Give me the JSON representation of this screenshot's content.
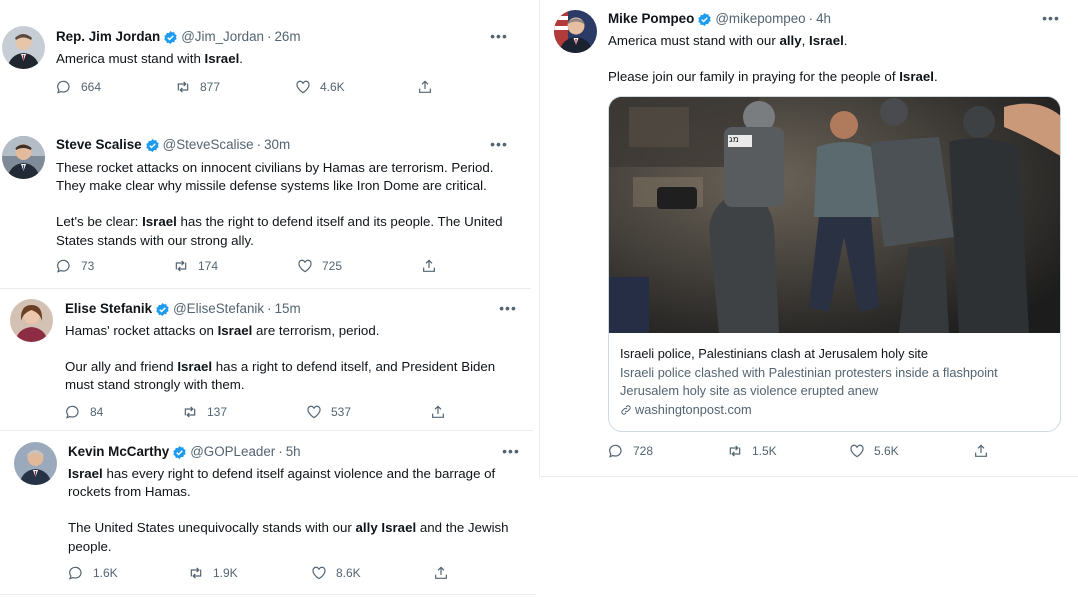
{
  "tweets": [
    {
      "name": "Rep. Jim Jordan",
      "handle": "@Jim_Jordan",
      "dot": "·",
      "time": "26m",
      "paragraphs": [
        [
          {
            "t": "America must stand with "
          },
          {
            "t": "Israel",
            "b": true
          },
          {
            "t": "."
          }
        ]
      ],
      "replies": "664",
      "retweets": "877",
      "likes": "4.6K"
    },
    {
      "name": "Steve Scalise",
      "handle": "@SteveScalise",
      "dot": "·",
      "time": "30m",
      "paragraphs": [
        [
          {
            "t": "These rocket attacks on innocent civilians by Hamas are terrorism. Period.\nThey make clear why missile defense systems like Iron Dome are critical."
          }
        ],
        [
          {
            "t": "Let's be clear: "
          },
          {
            "t": "Israel",
            "b": true
          },
          {
            "t": " has the right to defend itself and its people. The United\nStates stands with our strong ally."
          }
        ]
      ],
      "replies": "73",
      "retweets": "174",
      "likes": "725"
    },
    {
      "name": "Elise Stefanik",
      "handle": "@EliseStefanik",
      "dot": "·",
      "time": "15m",
      "paragraphs": [
        [
          {
            "t": "Hamas' rocket attacks on "
          },
          {
            "t": "Israel",
            "b": true
          },
          {
            "t": " are terrorism, period."
          }
        ],
        [
          {
            "t": "Our ally and friend "
          },
          {
            "t": "Israel",
            "b": true
          },
          {
            "t": " has a right to defend itself, and President Biden\nmust stand strongly with them."
          }
        ]
      ],
      "replies": "84",
      "retweets": "137",
      "likes": "537"
    },
    {
      "name": "Kevin McCarthy",
      "handle": "@GOPLeader",
      "dot": "·",
      "time": "5h",
      "paragraphs": [
        [
          {
            "t": "Israel",
            "b": true
          },
          {
            "t": " has every right to defend itself against violence and the barrage of\nrockets from Hamas."
          }
        ],
        [
          {
            "t": "The United States unequivocally stands with our "
          },
          {
            "t": "ally",
            "b": true
          },
          {
            "t": " "
          },
          {
            "t": "Israel",
            "b": true
          },
          {
            "t": " and the Jewish\npeople."
          }
        ]
      ],
      "replies": "1.6K",
      "retweets": "1.9K",
      "likes": "8.6K"
    },
    {
      "name": "Mike Pompeo",
      "handle": "@mikepompeo",
      "dot": "·",
      "time": "4h",
      "paragraphs": [
        [
          {
            "t": "America must stand with our "
          },
          {
            "t": "ally",
            "b": true
          },
          {
            "t": ", "
          },
          {
            "t": "Israel",
            "b": true
          },
          {
            "t": "."
          }
        ],
        [
          {
            "t": "Please join our family in praying for the people of "
          },
          {
            "t": "Israel",
            "b": true
          },
          {
            "t": "."
          }
        ]
      ],
      "replies": "728",
      "retweets": "1.5K",
      "likes": "5.6K",
      "card": {
        "title": "Israeli police, Palestinians clash at Jerusalem holy site",
        "description": "Israeli police clashed with Palestinian protesters inside a flashpoint Jerusalem holy site as violence erupted anew",
        "domain": "washingtonpost.com",
        "image_badge": "מג"
      }
    }
  ],
  "icons": {
    "more": "more-icon",
    "reply": "reply-icon",
    "retweet": "retweet-icon",
    "like": "like-icon",
    "share": "share-icon",
    "verified": "verified-badge-icon",
    "link": "link-icon"
  },
  "colors": {
    "text": "#0f1419",
    "secondary": "#536471",
    "verified": "#1d9bf0",
    "divider": "#e9ecee"
  }
}
